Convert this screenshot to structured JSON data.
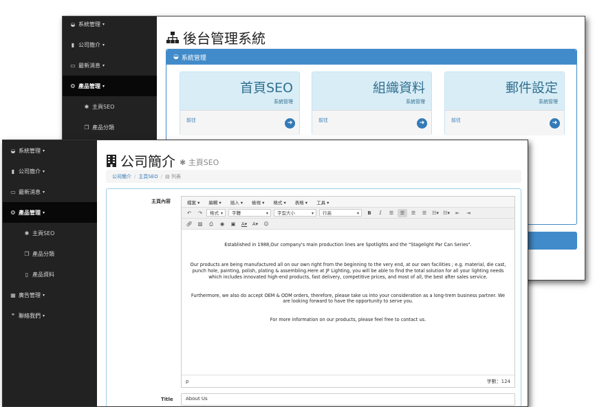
{
  "back_window": {
    "sidebar": [
      {
        "icon": "dashboard-icon",
        "glyph": "◒",
        "label": "系統管理",
        "caret": "▾"
      },
      {
        "icon": "building-icon",
        "glyph": "▮",
        "label": "公司簡介",
        "caret": "▾"
      },
      {
        "icon": "monitor-icon",
        "glyph": "▭",
        "label": "最新消息",
        "caret": "▾"
      },
      {
        "icon": "cube-icon",
        "glyph": "❂",
        "label": "產品管理",
        "caret": "▾"
      },
      {
        "icon": "gear-icon",
        "glyph": "✱",
        "label": "主頁SEO"
      },
      {
        "icon": "copy-icon",
        "glyph": "❐",
        "label": "產品分類"
      }
    ],
    "page_title": "後台管理系統",
    "panel_title": "系統管理",
    "cards": [
      {
        "title": "首頁SEO",
        "subtitle": "系統管理",
        "link": "前往"
      },
      {
        "title": "組織資料",
        "subtitle": "系統管理",
        "link": "前往"
      },
      {
        "title": "郵件設定",
        "subtitle": "系統管理",
        "link": "前往"
      }
    ]
  },
  "front_window": {
    "sidebar": [
      {
        "icon": "dashboard-icon",
        "glyph": "◒",
        "label": "系統管理",
        "caret": "▾"
      },
      {
        "icon": "building-icon",
        "glyph": "▮",
        "label": "公司簡介",
        "caret": "▾"
      },
      {
        "icon": "monitor-icon",
        "glyph": "▭",
        "label": "最新消息",
        "caret": "▾"
      },
      {
        "icon": "cube-icon",
        "glyph": "❂",
        "label": "產品管理",
        "caret": "▾"
      },
      {
        "icon": "gear-icon",
        "glyph": "✱",
        "label": "主頁SEO"
      },
      {
        "icon": "copy-icon",
        "glyph": "❐",
        "label": "產品分類"
      },
      {
        "icon": "file-icon",
        "glyph": "▯",
        "label": "產品資料"
      },
      {
        "icon": "grid-icon",
        "glyph": "▦",
        "label": "廣告管理",
        "caret": "▾"
      },
      {
        "icon": "chat-icon",
        "glyph": "❞",
        "label": "聯絡我們",
        "caret": "▾"
      }
    ],
    "page_title": "公司簡介",
    "page_subtitle": "主頁SEO",
    "breadcrumb": [
      "公司簡介",
      "主頁SEO",
      "列表"
    ],
    "field_label_content": "主頁內容",
    "field_label_title": "Title",
    "editor": {
      "menu": [
        "檔案 ▾",
        "編輯 ▾",
        "插入 ▾",
        "檢視 ▾",
        "格式 ▾",
        "表格 ▾",
        "工具 ▾"
      ],
      "format_dd": "格式",
      "font_dd": "字體",
      "size_dd": "字型大小",
      "line_dd": "行高",
      "paragraphs": [
        "Established in 1988,Our company's main production lines are Spotlights and the \"Stagelight Par Can Series\".",
        "Our products are being manufactured all on our own right from the beginning to the very end, at our own facilities ; e.g. material, die cast, punch hole, painting, polish, plating & assembling.Here at JF Lighting, you will be able to find the total solution for all your lighting needs which includes innovated high-end products, fast delivery, competitive prices, and most of all, the best after sales service.",
        "Furthermore, we also do accept OEM & ODM orders, therefore, please take us into your consideration as a long-trem business partner. We are looking forward to have the opportunity to serve you.",
        "For more information on our products, please feel free to contact us."
      ],
      "path": "p",
      "word_count": "字數：124"
    },
    "title_value": "About Us"
  }
}
